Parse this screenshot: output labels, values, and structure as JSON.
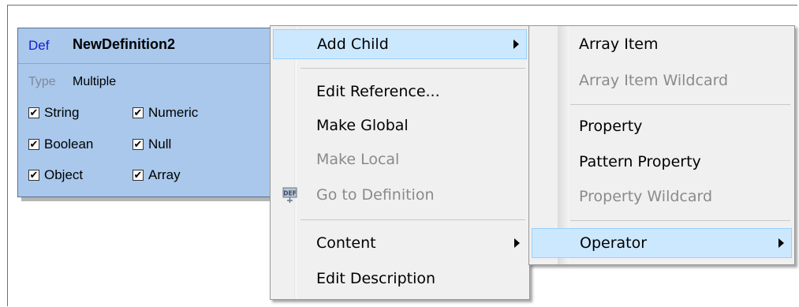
{
  "definition": {
    "def_keyword": "Def",
    "name": "NewDefinition2",
    "type_keyword": "Type",
    "type_value": "Multiple",
    "checkboxes": [
      {
        "label": "String",
        "checked": true
      },
      {
        "label": "Numeric",
        "checked": true
      },
      {
        "label": "Boolean",
        "checked": true
      },
      {
        "label": "Null",
        "checked": true
      },
      {
        "label": "Object",
        "checked": true
      },
      {
        "label": "Array",
        "checked": true
      }
    ]
  },
  "context_menu": {
    "add_child": "Add Child",
    "edit_reference": "Edit Reference...",
    "make_global": "Make Global",
    "make_local": "Make Local",
    "go_to_definition": "Go to Definition",
    "content": "Content",
    "edit_description": "Edit Description",
    "go_to_definition_icon": "def-icon"
  },
  "submenu": {
    "array_item": "Array Item",
    "array_item_wildcard": "Array Item Wildcard",
    "property": "Property",
    "pattern_property": "Pattern Property",
    "property_wildcard": "Property Wildcard",
    "operator": "Operator"
  },
  "colors": {
    "definition_bg": "#a9c8ec",
    "menu_bg": "#f0f0f0",
    "highlight_bg": "#cce8ff",
    "highlight_border": "#99d1ff",
    "def_keyword": "#1a1ad0",
    "disabled_text": "#8a8a8a"
  }
}
